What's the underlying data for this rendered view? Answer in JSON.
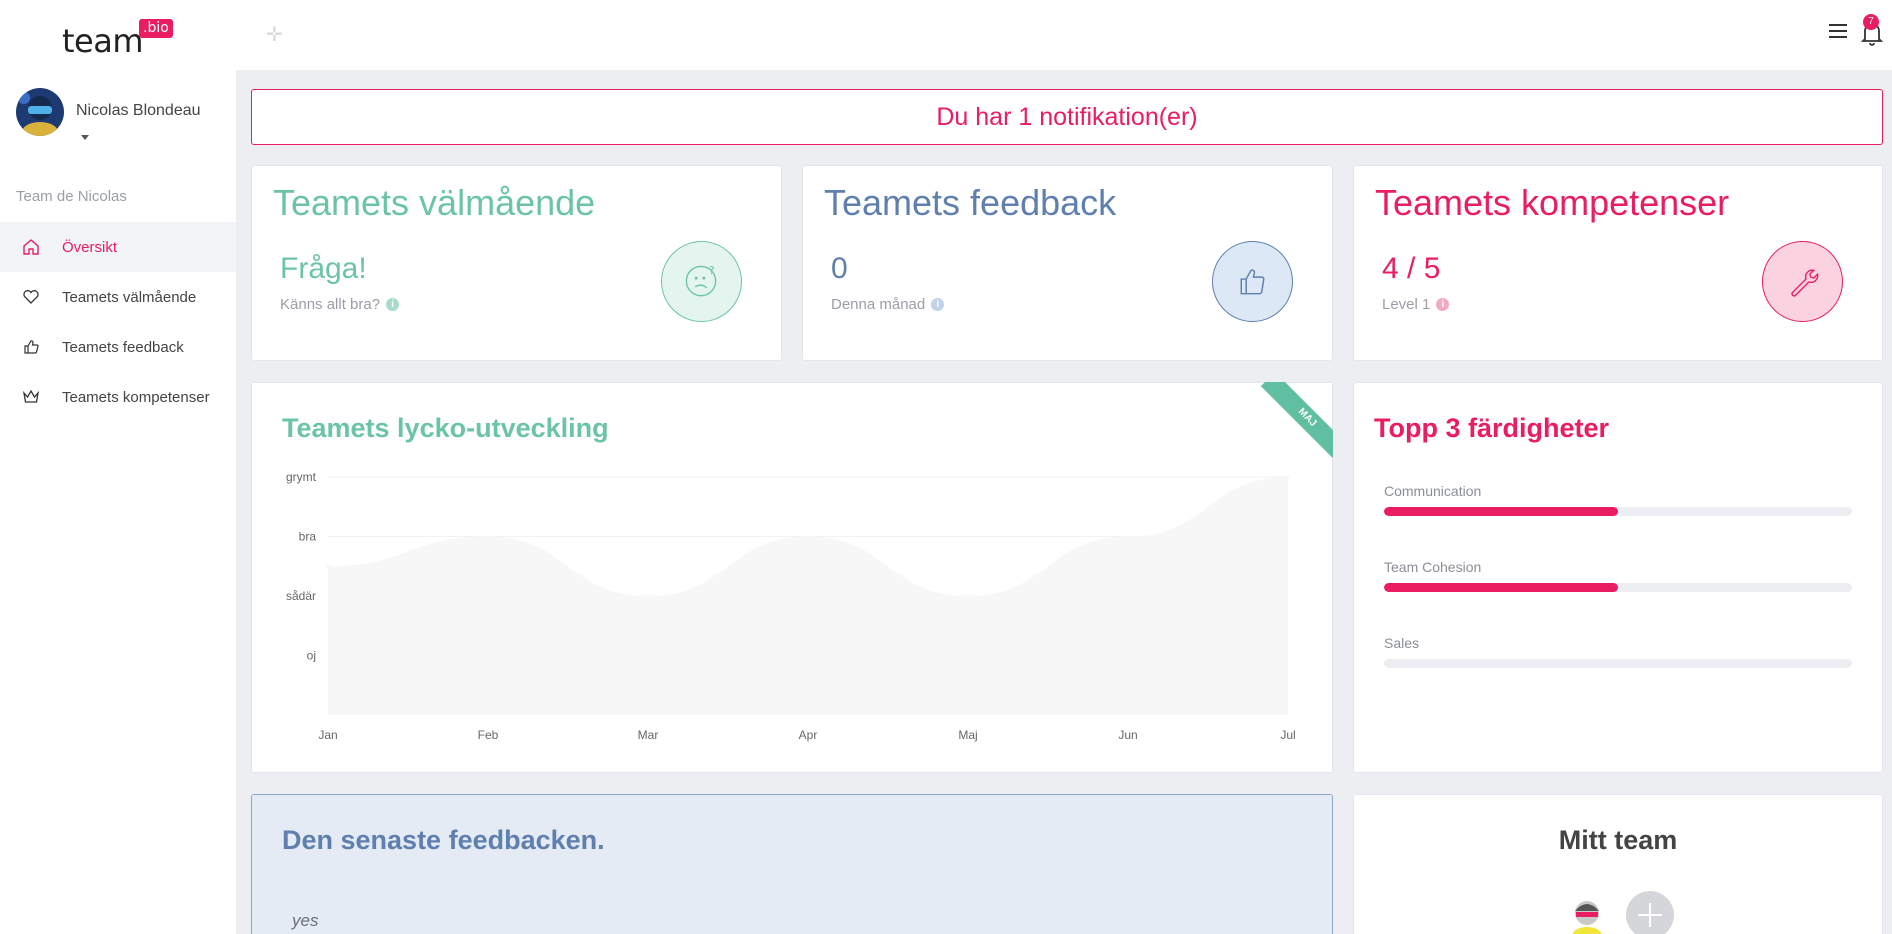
{
  "app": {
    "logo_text": "team",
    "logo_badge": ".bio",
    "notification_count": "7"
  },
  "colors": {
    "accent_pink": "#ea1c62",
    "green": "#6cc4a6",
    "blue": "#5f7fae"
  },
  "user": {
    "name": "Nicolas Blondeau",
    "team_label": "Team de Nicolas"
  },
  "sidebar": {
    "items": [
      {
        "label": "Översikt",
        "icon": "home-icon",
        "active": true
      },
      {
        "label": "Teamets välmående",
        "icon": "heart-icon",
        "active": false
      },
      {
        "label": "Teamets feedback",
        "icon": "thumbs-up-icon",
        "active": false
      },
      {
        "label": "Teamets kompetenser",
        "icon": "crown-icon",
        "active": false
      }
    ]
  },
  "notification": {
    "text": "Du har 1 notifikation(er)"
  },
  "cards": {
    "wellbeing": {
      "title": "Teamets välmående",
      "value": "Fråga!",
      "sub": "Känns allt bra?",
      "icon": "confused-face-icon"
    },
    "feedback": {
      "title": "Teamets feedback",
      "value": "0",
      "sub": "Denna månad",
      "icon": "thumbs-up-icon"
    },
    "skills": {
      "title": "Teamets kompetenser",
      "value": "4 / 5",
      "sub": "Level 1",
      "icon": "wrench-icon"
    }
  },
  "happiness_chart": {
    "title": "Teamets lycko-utveckling",
    "ribbon": "MAJ"
  },
  "chart_data": {
    "type": "area",
    "title": "Teamets lycko-utveckling",
    "categories": [
      "Jan",
      "Feb",
      "Mar",
      "Apr",
      "Maj",
      "Jun",
      "Jul"
    ],
    "y_labels": [
      "oj",
      "sådär",
      "bra",
      "grymt"
    ],
    "values": [
      2.5,
      3.0,
      2.0,
      3.0,
      2.0,
      3.0,
      4.0
    ],
    "ylim": [
      0,
      4
    ],
    "grid": true
  },
  "top_skills": {
    "title": "Topp 3 färdigheter",
    "items": [
      {
        "name": "Communication",
        "level": 0.5
      },
      {
        "name": "Team Cohesion",
        "level": 0.5
      },
      {
        "name": "Sales",
        "level": 0
      }
    ]
  },
  "latest_feedback": {
    "title": "Den senaste feedbacken.",
    "items": [
      "yes"
    ]
  },
  "my_team": {
    "title": "Mitt team"
  }
}
